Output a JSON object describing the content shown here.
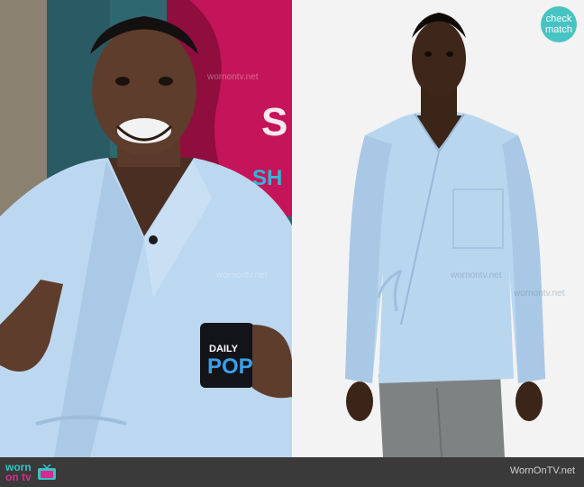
{
  "badge": {
    "line1": "check",
    "line2": "match"
  },
  "mug": {
    "line1": "DAILY",
    "line2": "POP"
  },
  "footer": {
    "logo_worn": "worn",
    "logo_on": "on tv",
    "site": "WornOnTV.net"
  },
  "watermarks": [
    "wornontv.net",
    "wornontv.net",
    "wornontv.net",
    "wornontv.net"
  ],
  "colors": {
    "shirt": "#b9d6ef",
    "badge": "#48c3c3",
    "footer": "#3a3a3a",
    "brand_teal": "#39c1c6",
    "brand_pink": "#d12f8d"
  }
}
